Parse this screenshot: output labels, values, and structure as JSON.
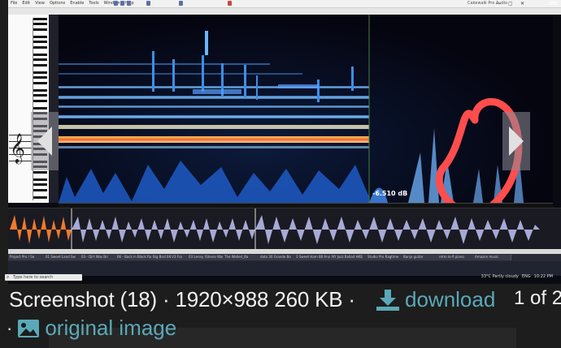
{
  "app": {
    "menu": [
      "File",
      "Edit",
      "View",
      "Options",
      "Enable",
      "Tools",
      "Window",
      "Help"
    ],
    "window_title": "Cakewalk Pro Audio",
    "corner_label": "ofto",
    "win_controls": [
      "—",
      "▢",
      "✕"
    ]
  },
  "spectrogram": {
    "db_readout": "-6.510 dB"
  },
  "taskbar": {
    "search_placeholder": "Type here to search",
    "tabs": [
      "Project Pro / Se",
      "01 Sweet Land Sw",
      "03 - Dirt Was Bri",
      "06 - Back in Black Ra",
      "Big Bird 08 V3 Fra",
      "03 Lenny (Stevie Wanth",
      "The Walled_Ba",
      "data 30 Grande Bo",
      "3 Sweet Ham 88 Ana",
      "NY Jazz Ballad HKB",
      "Studio Pro Ragtime",
      "Banjo guitar",
      "retro lo-fi piano",
      "Amazon music"
    ],
    "tray": [
      "33°C Partly cloudy",
      "ENG",
      "10:22 PM"
    ]
  },
  "caption": {
    "file_info": "Screenshot (18) · 1920×988 260 KB ·",
    "download_label": "download",
    "pager": "1 of 2",
    "separator": "·",
    "original_label": "original image"
  },
  "colors": {
    "link": "#5aa9b8",
    "annotation_circle": "#ff4d4d",
    "waveform_orange": "#f07a2a",
    "waveform_lilac": "#a7a9d6"
  }
}
